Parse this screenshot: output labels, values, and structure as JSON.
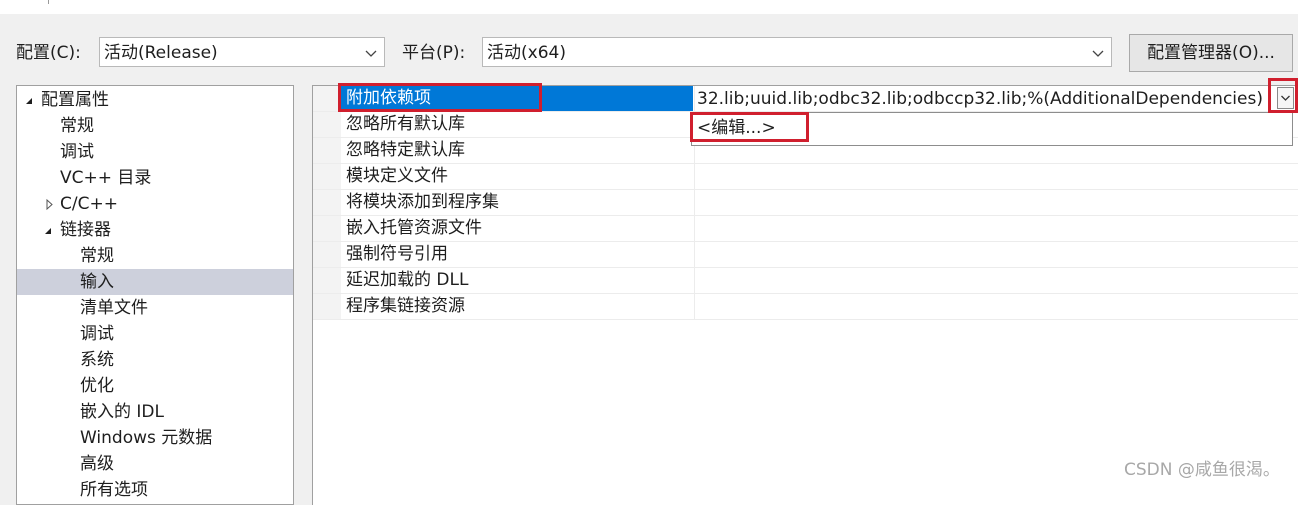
{
  "config_bar": {
    "config_label": "配置(C):",
    "config_value": "活动(Release)",
    "platform_label": "平台(P):",
    "platform_value": "活动(x64)",
    "manager_button": "配置管理器(O)..."
  },
  "tree": {
    "items": [
      {
        "label": "配置属性",
        "expander": "expanded"
      },
      {
        "label": "常规"
      },
      {
        "label": "调试"
      },
      {
        "label": "VC++ 目录"
      },
      {
        "label": "C/C++",
        "expander": "collapsed"
      },
      {
        "label": "链接器",
        "expander": "expanded"
      },
      {
        "label": "常规"
      },
      {
        "label": "输入",
        "selected": true
      },
      {
        "label": "清单文件"
      },
      {
        "label": "调试"
      },
      {
        "label": "系统"
      },
      {
        "label": "优化"
      },
      {
        "label": "嵌入的 IDL"
      },
      {
        "label": "Windows 元数据"
      },
      {
        "label": "高级"
      },
      {
        "label": "所有选项"
      }
    ]
  },
  "properties": {
    "rows": [
      {
        "name": "附加依赖项",
        "value": "32.lib;uuid.lib;odbc32.lib;odbccp32.lib;%(AdditionalDependencies)",
        "selected": true
      },
      {
        "name": "忽略所有默认库",
        "value": ""
      },
      {
        "name": "忽略特定默认库",
        "value": ""
      },
      {
        "name": "模块定义文件",
        "value": ""
      },
      {
        "name": "将模块添加到程序集",
        "value": ""
      },
      {
        "name": "嵌入托管资源文件",
        "value": ""
      },
      {
        "name": "强制符号引用",
        "value": ""
      },
      {
        "name": "延迟加载的 DLL",
        "value": ""
      },
      {
        "name": "程序集链接资源",
        "value": ""
      }
    ],
    "dropdown_item": "<编辑...>"
  },
  "watermark": "CSDN @咸鱼很渴。",
  "colors": {
    "selection": "#0078d7",
    "tree_selection": "#cdd0dc",
    "highlight_box": "#d01f2e"
  }
}
